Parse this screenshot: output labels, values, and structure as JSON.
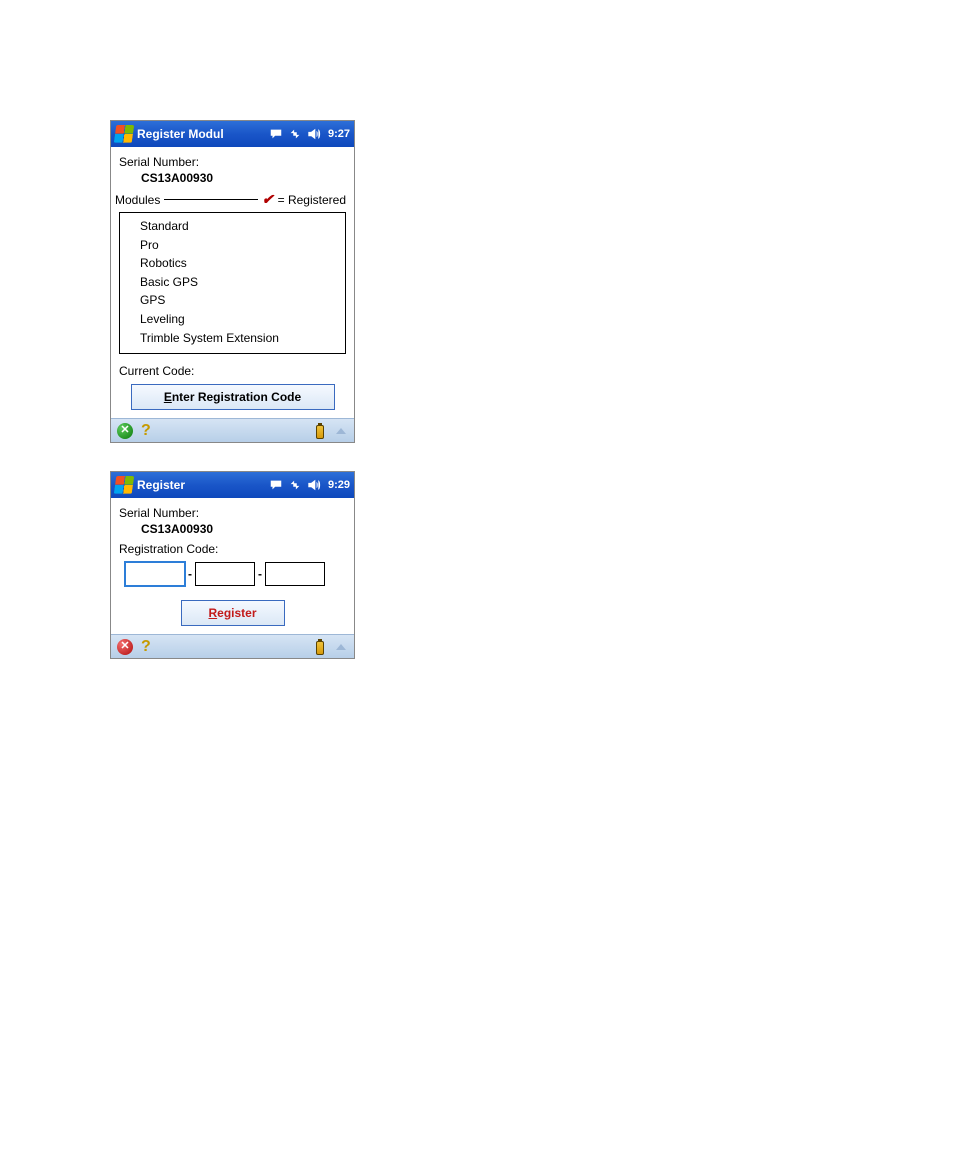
{
  "screen1": {
    "title": "Register Modul",
    "time": "9:27",
    "serial_label": "Serial Number:",
    "serial_value": "CS13A00930",
    "modules_label": "Modules",
    "registered_label": "= Registered",
    "modules": [
      "Standard",
      "Pro",
      "Robotics",
      "Basic GPS",
      "GPS",
      "Leveling",
      "Trimble System Extension"
    ],
    "current_code_label": "Current Code:",
    "enter_btn_prefix": "E",
    "enter_btn_rest": "nter Registration Code"
  },
  "screen2": {
    "title": "Register",
    "time": "9:29",
    "serial_label": "Serial Number:",
    "serial_value": "CS13A00930",
    "reg_code_label": "Registration Code:",
    "code1": "",
    "code2": "",
    "code3": "",
    "register_btn_prefix": "R",
    "register_btn_rest": "egister"
  }
}
